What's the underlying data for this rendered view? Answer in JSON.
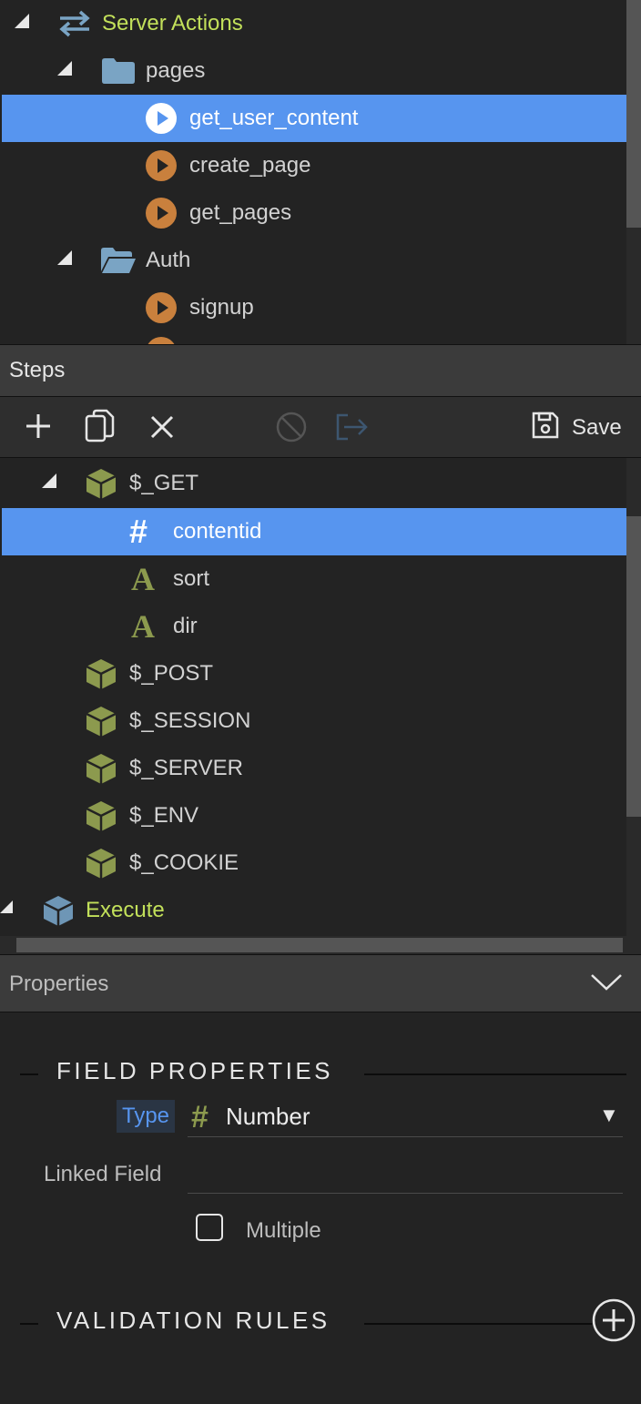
{
  "tree": {
    "server_actions": "Server Actions",
    "pages_folder": "pages",
    "items": [
      "get_user_content",
      "create_page",
      "get_pages"
    ],
    "auth_folder": "Auth",
    "auth_items": [
      "signup"
    ]
  },
  "steps": {
    "title": "Steps",
    "save_label": "Save",
    "get_label": "$_GET",
    "get_params": [
      "contentid",
      "sort",
      "dir"
    ],
    "globals": [
      "$_POST",
      "$_SESSION",
      "$_SERVER",
      "$_ENV",
      "$_COOKIE"
    ],
    "execute_label": "Execute"
  },
  "properties": {
    "title": "Properties",
    "field_properties_heading": "FIELD PROPERTIES",
    "type_label": "Type",
    "type_value": "Number",
    "type_icon": "#",
    "linked_field_label": "Linked Field",
    "linked_field_value": "",
    "multiple_label": "Multiple",
    "multiple_checked": false,
    "validation_heading": "VALIDATION RULES"
  },
  "colors": {
    "selection": "#5795ef",
    "accent_green": "#c2e05a",
    "action_orange": "#c9803d",
    "cube_olive": "#8c9a4e",
    "execute_cube": "#6e96b6"
  }
}
